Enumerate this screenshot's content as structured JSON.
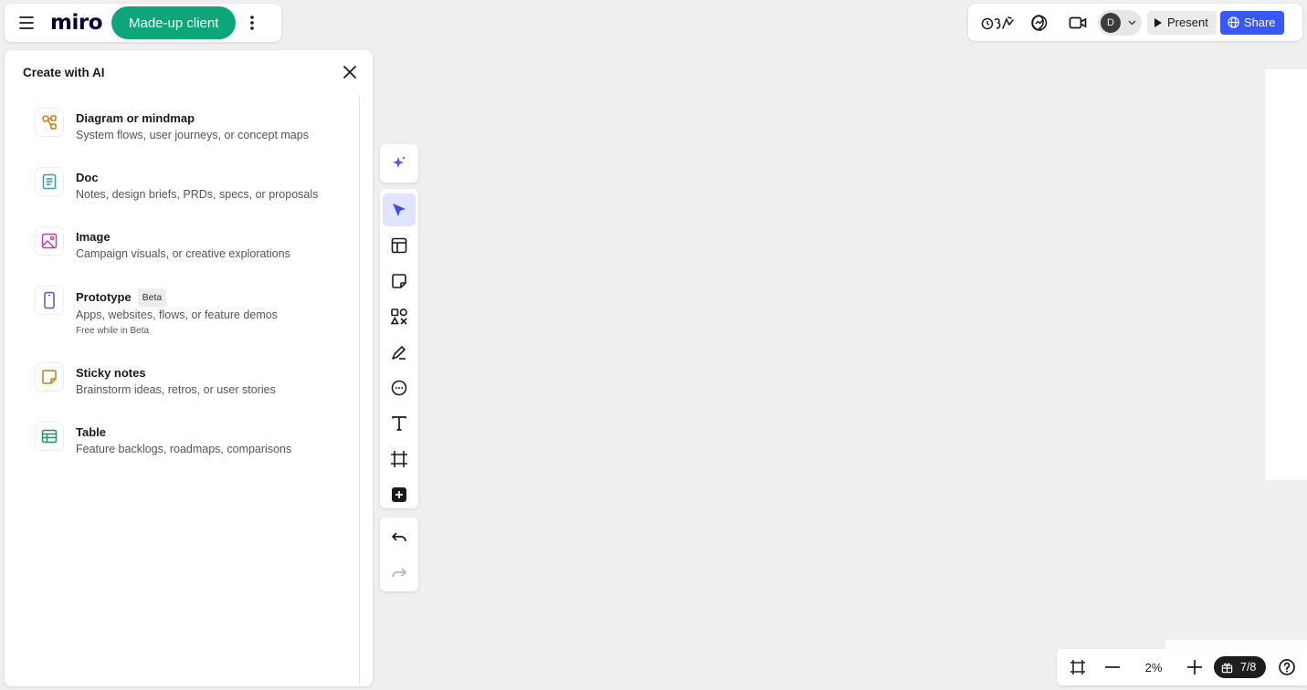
{
  "app": {
    "logo_text": "miro",
    "board_name": "Made-up client"
  },
  "topbar": {
    "reactions_icon": "reactions-icon",
    "present_label": "Present",
    "share_label": "Share",
    "avatar_initial": "D"
  },
  "ai_panel": {
    "title": "Create with AI",
    "items": [
      {
        "title": "Diagram or mindmap",
        "description": "System flows, user journeys, or concept maps",
        "icon": "diagram-icon",
        "color": "#c27d13"
      },
      {
        "title": "Doc",
        "description": "Notes, design briefs, PRDs, specs, or proposals",
        "icon": "doc-icon",
        "color": "#2a9fae"
      },
      {
        "title": "Image",
        "description": "Campaign visuals, or creative explorations",
        "icon": "image-icon",
        "color": "#c13ea6"
      },
      {
        "title": "Prototype",
        "badge": "Beta",
        "description": "Apps, websites, flows, or feature demos",
        "note": "Free while in Beta",
        "icon": "prototype-icon",
        "color": "#5a55c4"
      },
      {
        "title": "Sticky notes",
        "description": "Brainstorm ideas, retros, or user stories",
        "icon": "sticky-note-icon",
        "color": "#c27d13"
      },
      {
        "title": "Table",
        "description": "Feature backlogs, roadmaps, comparisons",
        "icon": "table-icon",
        "color": "#119a5a"
      }
    ]
  },
  "toolbar": {
    "tools": [
      "ai-sparkle",
      "select",
      "templates",
      "sticky-note",
      "shapes",
      "pen",
      "comment",
      "text",
      "frame",
      "more-apps",
      "undo",
      "redo"
    ]
  },
  "bottom": {
    "zoom_label": "2%",
    "page_indicator": "7/8"
  },
  "colors": {
    "accent_green": "#0ca678",
    "accent_blue": "#3859ff",
    "toolbar_active": "#e0e5ff"
  }
}
